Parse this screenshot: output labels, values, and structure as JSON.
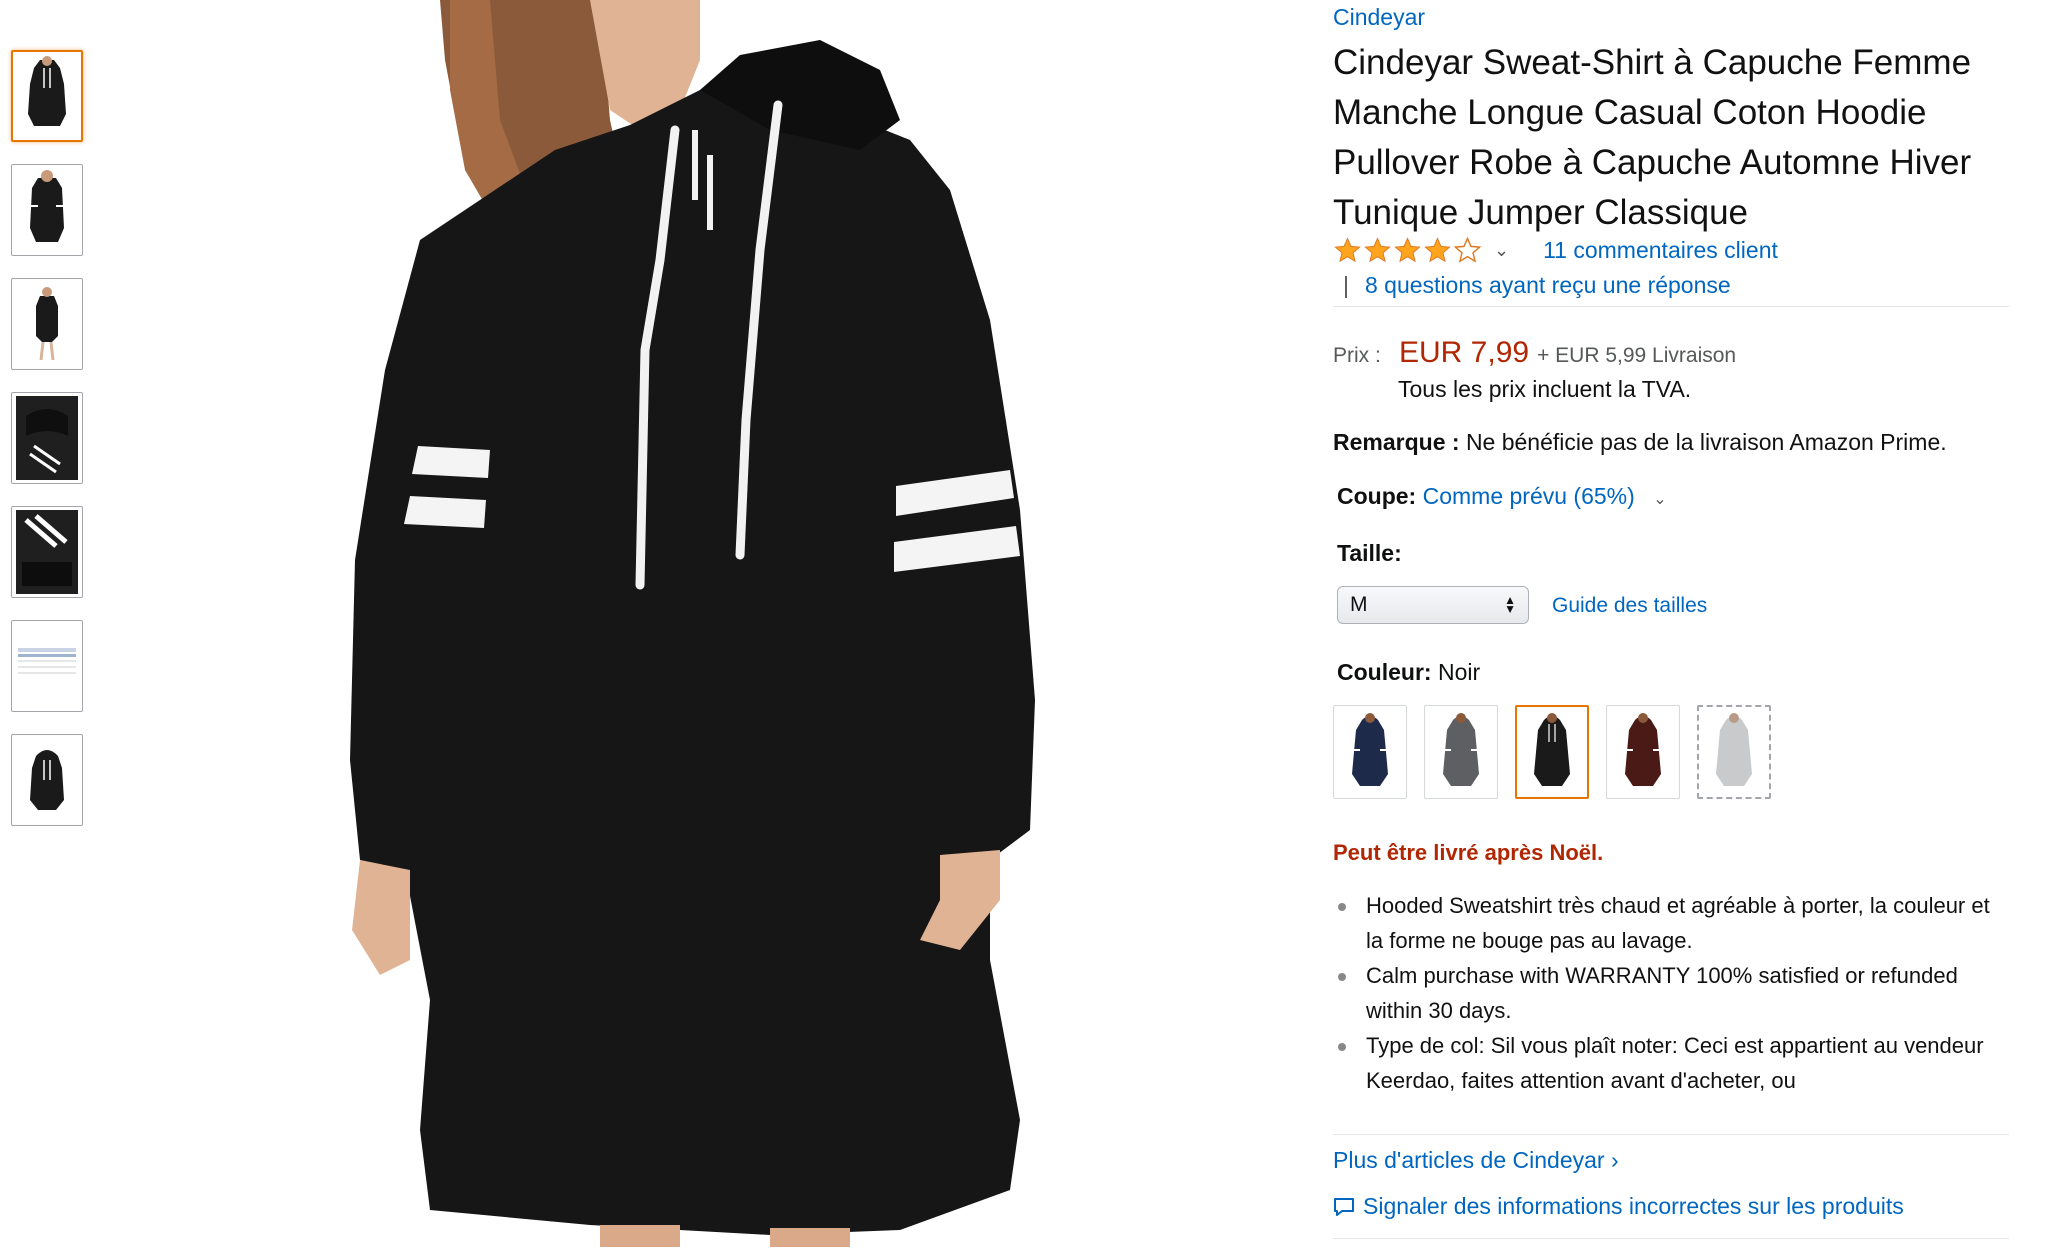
{
  "brand": "Cindeyar",
  "title": "Cindeyar Sweat-Shirt à Capuche Femme Manche Longue Casual Coton Hoodie Pullover Robe à Capuche Automne Hiver Tunique Jumper Classique",
  "rating": {
    "stars": 4,
    "max": 5,
    "reviews_label": "11 commentaires client",
    "qa_separator": "|",
    "qa_label": "8 questions ayant reçu une réponse"
  },
  "price": {
    "label": "Prix :",
    "value": "EUR 7,99",
    "shipping": "+ EUR 5,99 Livraison",
    "vat": "Tous les prix incluent la TVA."
  },
  "remark": {
    "label": "Remarque :",
    "text": "Ne bénéficie pas de la livraison Amazon Prime."
  },
  "fit": {
    "label": "Coupe:",
    "value": "Comme prévu (65%)"
  },
  "size": {
    "label": "Taille:",
    "selected": "M",
    "guide": "Guide des tailles"
  },
  "color": {
    "label": "Couleur:",
    "selected": "Noir",
    "swatches": [
      {
        "name": "navy",
        "hex": "#1d2a4a"
      },
      {
        "name": "grey",
        "hex": "#5e5f63"
      },
      {
        "name": "black",
        "hex": "#1a1a1a"
      },
      {
        "name": "burgundy",
        "hex": "#4a1a17"
      },
      {
        "name": "light-grey",
        "hex": "#c9cacc"
      }
    ]
  },
  "delivery_note": "Peut être livré après Noël.",
  "bullets": [
    "Hooded Sweatshirt très chaud et agréable à porter, la couleur et la forme ne bouge pas au lavage.",
    "Calm purchase with WARRANTY 100% satisfied or refunded within 30 days.",
    "Type de col: Sil vous plaît noter: Ceci est appartient au vendeur Keerdao, faites attention avant d'acheter, ou"
  ],
  "more_from_brand": "Plus d'articles de Cindeyar ›",
  "report_link": "Signaler des informations incorrectes sur les produits",
  "colors": {
    "link": "#0066C0",
    "price": "#B12704",
    "star": "#FFA41C",
    "selected_border": "#e77600"
  }
}
